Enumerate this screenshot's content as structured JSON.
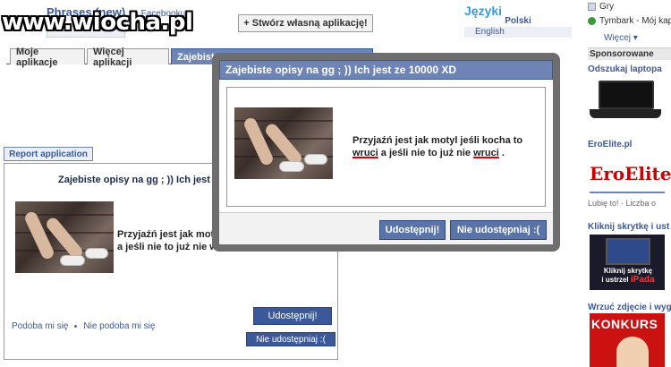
{
  "header": {
    "app_title": "Phrases (new)",
    "app_title_suffix": "na Facebooku",
    "watermark": "www.wiocha.pl",
    "create_app_button": "+ Stwórz własną aplikację!"
  },
  "languages": {
    "title": "Języki",
    "polski": "Polski",
    "english": "English"
  },
  "tabs": [
    {
      "label": "Moje aplikacje"
    },
    {
      "label": "Więcej aplikacji"
    },
    {
      "label": "Zajebiste opisy na gg ; )) Ich jest ze 10000 XD"
    }
  ],
  "report_button": "Report application",
  "content": {
    "title": "Zajebiste opisy na gg ; )) Ich jest ze 10000 XD",
    "text_line1": "Przyjaźń jest jak motyl jeśli kocha to wruci",
    "text_line2": "a jeśli nie to już nie wruci .",
    "share_button": "Udostępnij!",
    "no_share_button": "Nie udostępniaj :(",
    "like_link": "Podoba mi się",
    "dislike_link": "Nie podoba mi się"
  },
  "dialog": {
    "title": "Zajebiste opisy na gg ; )) Ich jest ze 10000 XD",
    "text_part1": "Przyjaźń jest jak motyl jeśli kocha to",
    "text_word1": "wruci",
    "text_part2": " a jeśli nie to już nie ",
    "text_word2": "wruci",
    "text_part3": " .",
    "share_button": "Udostępnij!",
    "no_share_button": "Nie udostępniaj :("
  },
  "sidebar": {
    "items": [
      {
        "label": "Gry"
      },
      {
        "label": "Tymbark - Mój kap"
      }
    ],
    "more_link": "Więcej",
    "sponsored_title": "Sponsorowane",
    "ads": [
      {
        "title": "Odszukaj laptopa"
      },
      {
        "title": "EroElite.pl",
        "logo_text": "EroElite.pl",
        "like_text": "Lubię to! · Liczba o"
      },
      {
        "title": "Kliknij skrytkę i ust",
        "image_text_line1": "Kliknij skrytkę",
        "image_text_line2": "i ustrzel",
        "image_text_line3": "iPada"
      },
      {
        "title": "Wrzuć zdjęcie i wyg",
        "image_text": "KONKURS"
      }
    ]
  },
  "colors": {
    "facebook_blue": "#3b5998",
    "tab_active": "#6d84b4",
    "dialog_frame": "#6e6e6e",
    "underline_red": "#dd0000"
  }
}
